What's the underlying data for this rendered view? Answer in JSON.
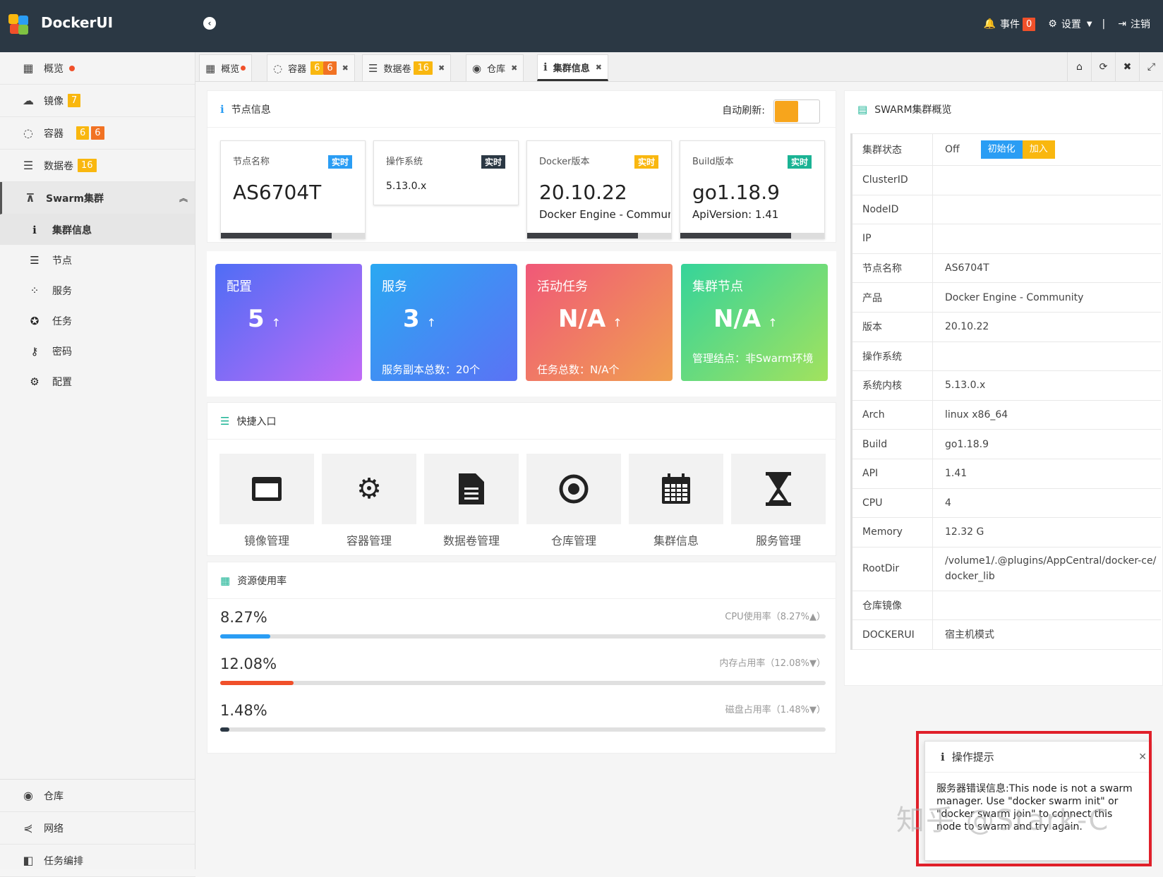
{
  "app": {
    "brand": "DockerUI"
  },
  "topbar": {
    "events_label": "事件",
    "events_count": "0",
    "settings_label": "设置",
    "logout_label": "注销"
  },
  "sidebar": {
    "items": [
      {
        "label": "概览",
        "icon": "windows-icon"
      },
      {
        "label": "镜像",
        "icon": "cloud-icon",
        "badge": "7"
      },
      {
        "label": "容器",
        "icon": "spinner-icon",
        "badge1": "6",
        "badge2": "6"
      },
      {
        "label": "数据卷",
        "icon": "database-icon",
        "badge": "16"
      },
      {
        "label": "Swarm集群",
        "icon": "sitemap-icon"
      }
    ],
    "sub_items": [
      {
        "label": "集群信息",
        "icon": "info-icon"
      },
      {
        "label": "节点",
        "icon": "server-icon"
      },
      {
        "label": "服务",
        "icon": "spinner-dots-icon"
      },
      {
        "label": "任务",
        "icon": "rebel-icon"
      },
      {
        "label": "密码",
        "icon": "key-icon"
      },
      {
        "label": "配置",
        "icon": "gear-icon"
      }
    ],
    "bottom_items": [
      {
        "label": "仓库",
        "icon": "podcast-icon"
      },
      {
        "label": "网络",
        "icon": "share-icon"
      },
      {
        "label": "任务编排",
        "icon": "cubes-icon"
      }
    ]
  },
  "tabs": [
    {
      "label": "概览"
    },
    {
      "label": "容器",
      "badge1": "6",
      "badge2": "6"
    },
    {
      "label": "数据卷",
      "badge": "16"
    },
    {
      "label": "仓库"
    },
    {
      "label": "集群信息"
    }
  ],
  "node_info": {
    "title": "节点信息",
    "auto_refresh_label": "自动刷新:",
    "auto_refresh_on": true,
    "cards": [
      {
        "label": "节点名称",
        "tag": "实时",
        "value": "AS6704T",
        "sub": "",
        "progress": 0.77
      },
      {
        "label": "操作系统",
        "tag": "实时",
        "value": "5.13.0.x",
        "sub": ""
      },
      {
        "label": "Docker版本",
        "tag": "实时",
        "value": "20.10.22",
        "sub": "Docker Engine - Community",
        "progress": 0.77
      },
      {
        "label": "Build版本",
        "tag": "实时",
        "value": "go1.18.9",
        "sub": "ApiVersion: 1.41",
        "progress": 0.77
      }
    ]
  },
  "stats": [
    {
      "title": "配置",
      "value": "5",
      "arrow": "↑",
      "footer": ""
    },
    {
      "title": "服务",
      "value": "3",
      "arrow": "↑",
      "footer": "服务副本总数：20个"
    },
    {
      "title": "活动任务",
      "value": "N/A",
      "arrow": "↑",
      "footer": "任务总数：N/A个"
    },
    {
      "title": "集群节点",
      "value": "N/A",
      "arrow": "↑",
      "footer": "管理结点：非Swarm环境"
    }
  ],
  "quick": {
    "title": "快捷入口",
    "items": [
      {
        "label": "镜像管理",
        "icon": "window-icon"
      },
      {
        "label": "容器管理",
        "icon": "gears-icon"
      },
      {
        "label": "数据卷管理",
        "icon": "file-icon"
      },
      {
        "label": "仓库管理",
        "icon": "dot-circle-icon"
      },
      {
        "label": "集群信息",
        "icon": "calendar-icon"
      },
      {
        "label": "服务管理",
        "icon": "hourglass-icon"
      }
    ]
  },
  "resources": {
    "title": "资源使用率",
    "rows": [
      {
        "value": "8.27%",
        "caption": "CPU使用率（8.27%▲）",
        "level": 0.0827,
        "color": "#2a9df4"
      },
      {
        "value": "12.08%",
        "caption": "内存占用率（12.08%▼）",
        "level": 0.1208,
        "color": "#f0502a"
      },
      {
        "value": "1.48%",
        "caption": "磁盘占用率（1.48%▼）",
        "level": 0.0148,
        "color": "#2b3844"
      }
    ]
  },
  "swarm": {
    "title": "SWARM集群概览",
    "status_key": "集群状态",
    "status_value": "Off",
    "init_label": "初始化",
    "join_label": "加入",
    "rows": [
      {
        "k": "ClusterID",
        "v": ""
      },
      {
        "k": "NodeID",
        "v": ""
      },
      {
        "k": "IP",
        "v": ""
      },
      {
        "k": "节点名称",
        "v": "AS6704T"
      },
      {
        "k": "产品",
        "v": "Docker Engine - Community"
      },
      {
        "k": "版本",
        "v": "20.10.22"
      },
      {
        "k": "操作系统",
        "v": ""
      },
      {
        "k": "系统内核",
        "v": "5.13.0.x"
      },
      {
        "k": "Arch",
        "v": "linux x86_64"
      },
      {
        "k": "Build",
        "v": "go1.18.9"
      },
      {
        "k": "API",
        "v": "1.41"
      },
      {
        "k": "CPU",
        "v": "4"
      },
      {
        "k": "Memory",
        "v": "12.32 G"
      },
      {
        "k": "RootDir",
        "v": "/volume1/.@plugins/AppCentral/docker-ce/docker_lib"
      },
      {
        "k": "仓库镜像",
        "v": ""
      },
      {
        "k": "DOCKERUI",
        "v": "宿主机模式"
      }
    ]
  },
  "toast": {
    "title": "操作提示",
    "body": "服务器错误信息:This node is not a swarm manager. Use \"docker swarm init\" or \"docker swarm join\" to connect this node to swarm and try again."
  },
  "watermark": "知乎 @Stark-C",
  "colors": {
    "topbar": "#2b3844",
    "accent_orange": "#f7a51c",
    "badge_red": "#f0502a",
    "badge_yellow": "#f9b70f"
  }
}
